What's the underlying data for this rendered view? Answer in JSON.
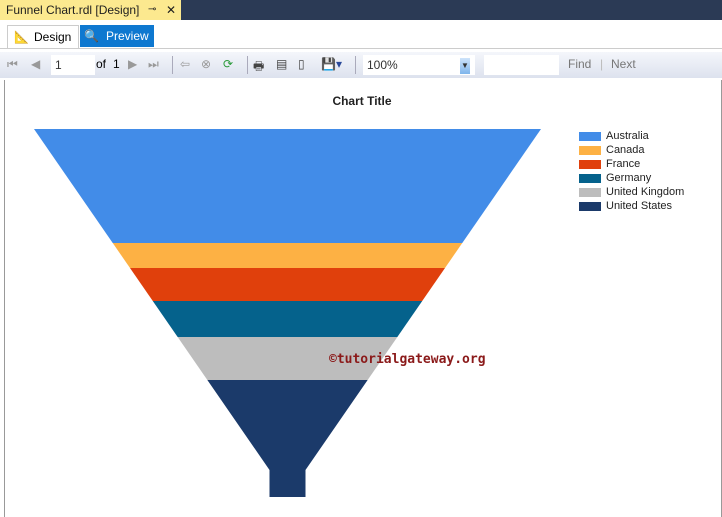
{
  "window": {
    "doc_tab": "Funnel Chart.rdl [Design]",
    "pin": "⊸",
    "close": "✕"
  },
  "tabs": [
    {
      "label": "Design"
    },
    {
      "label": "Preview"
    }
  ],
  "toolbar": {
    "page": "1",
    "of_label": "of",
    "total_pages": "1",
    "zoom": "100%",
    "find": "Find",
    "sep": "|",
    "next": "Next"
  },
  "chart_data": {
    "type": "funnel",
    "title": "Chart Title",
    "categories": [
      "Australia",
      "Canada",
      "France",
      "Germany",
      "United Kingdom",
      "United States"
    ],
    "values": [
      114,
      25,
      33,
      36,
      43,
      117
    ],
    "colors": [
      "#428ce8",
      "#fdb144",
      "#e0400c",
      "#05628c",
      "#bdbdbd",
      "#1b3a6a"
    ],
    "legend": "top-right"
  },
  "watermark": "©tutorialgateway.org"
}
